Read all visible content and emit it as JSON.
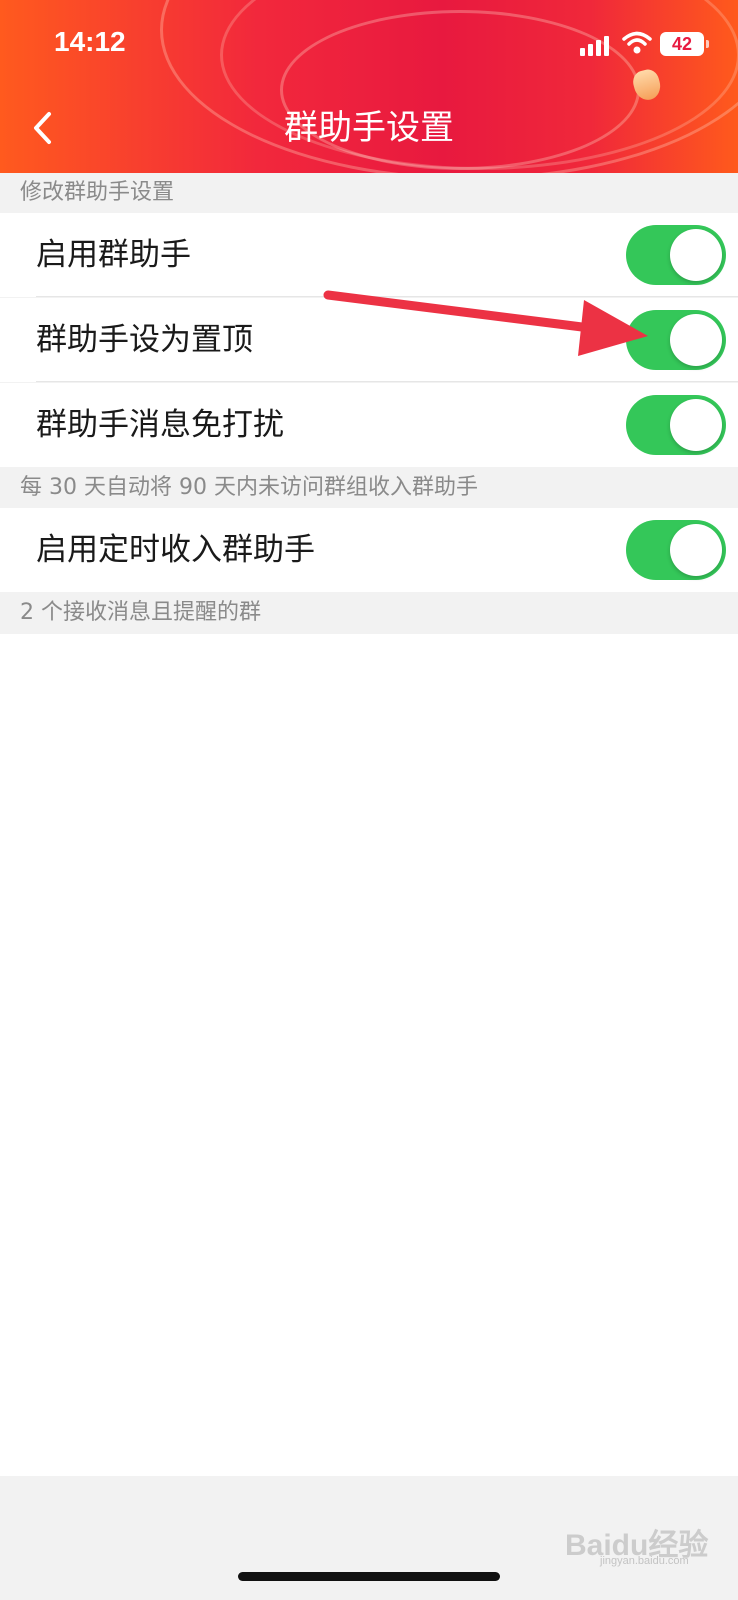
{
  "status_bar": {
    "time": "14:12",
    "battery": "42"
  },
  "header": {
    "title": "群助手设置",
    "back_icon": "chevron-left-icon"
  },
  "sections": {
    "modify_label": "修改群助手设置",
    "auto_label": "每 30 天自动将 90 天内未访问群组收入群助手",
    "groups_label": "2 个接收消息且提醒的群"
  },
  "settings": [
    {
      "label": "启用群助手",
      "enabled": true
    },
    {
      "label": "群助手设为置顶",
      "enabled": true
    },
    {
      "label": "群助手消息免打扰",
      "enabled": true
    },
    {
      "label": "启用定时收入群助手",
      "enabled": true
    }
  ],
  "watermark": {
    "text": "Baidu经验",
    "sub": "jingyan.baidu.com"
  },
  "colors": {
    "toggle_on": "#34c759",
    "header_red": "#e8193f",
    "arrow": "#ec3244"
  }
}
